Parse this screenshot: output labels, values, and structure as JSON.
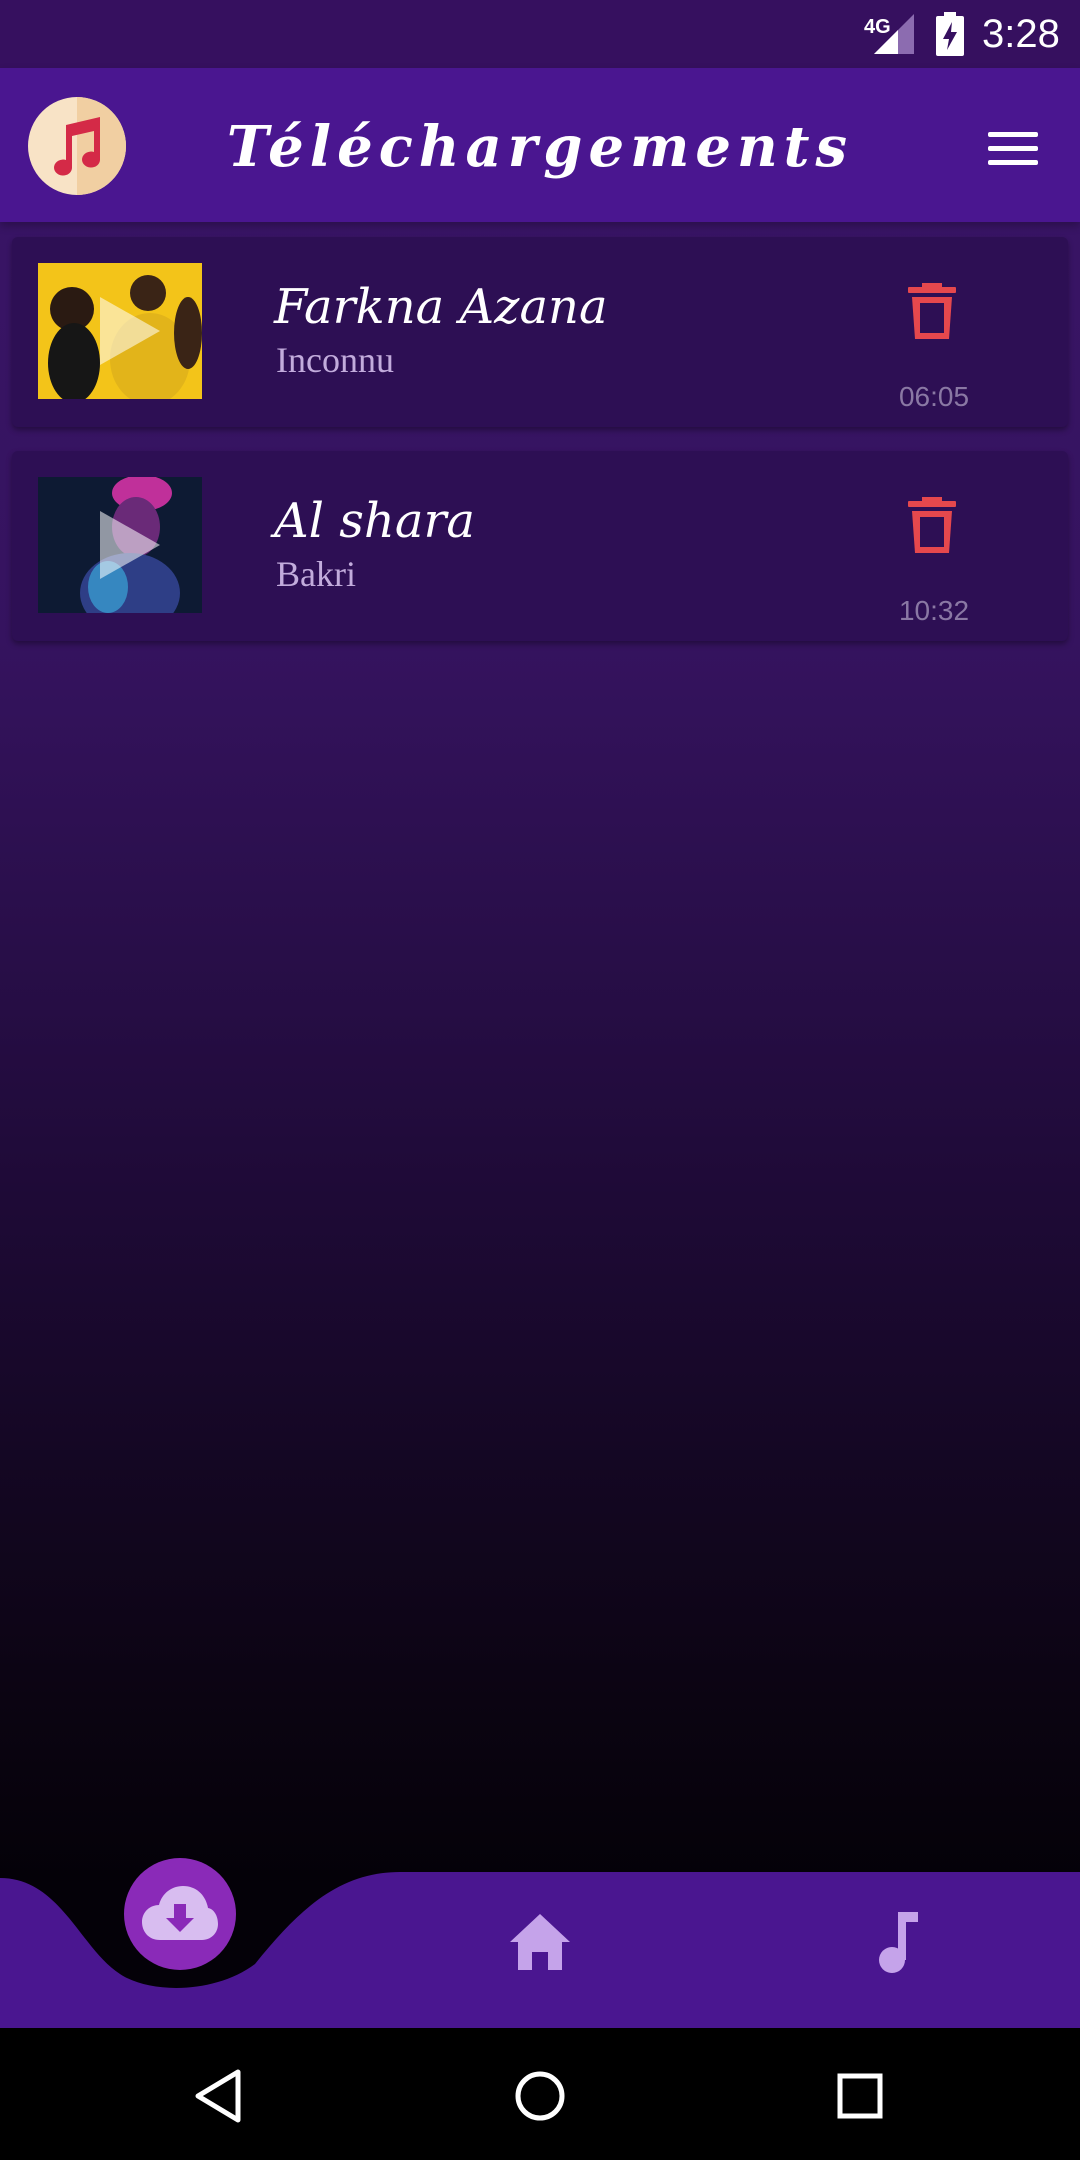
{
  "status_bar": {
    "network": "4G",
    "time": "3:28"
  },
  "header": {
    "title": "Téléchargements"
  },
  "downloads": [
    {
      "title": "Farkna Azana",
      "artist": "Inconnu",
      "duration": "06:05"
    },
    {
      "title": "Al shara",
      "artist": "Bakri",
      "duration": "10:32"
    }
  ],
  "bottom_nav": {
    "items": [
      {
        "icon": "cloud-download-icon",
        "active": true
      },
      {
        "icon": "home-icon",
        "active": false
      },
      {
        "icon": "music-note-icon",
        "active": false
      }
    ]
  },
  "colors": {
    "app_bar": "#4a1690",
    "accent": "#8a2ab8",
    "delete": "#e5484d",
    "nav_icon": "#c5a3ea"
  }
}
